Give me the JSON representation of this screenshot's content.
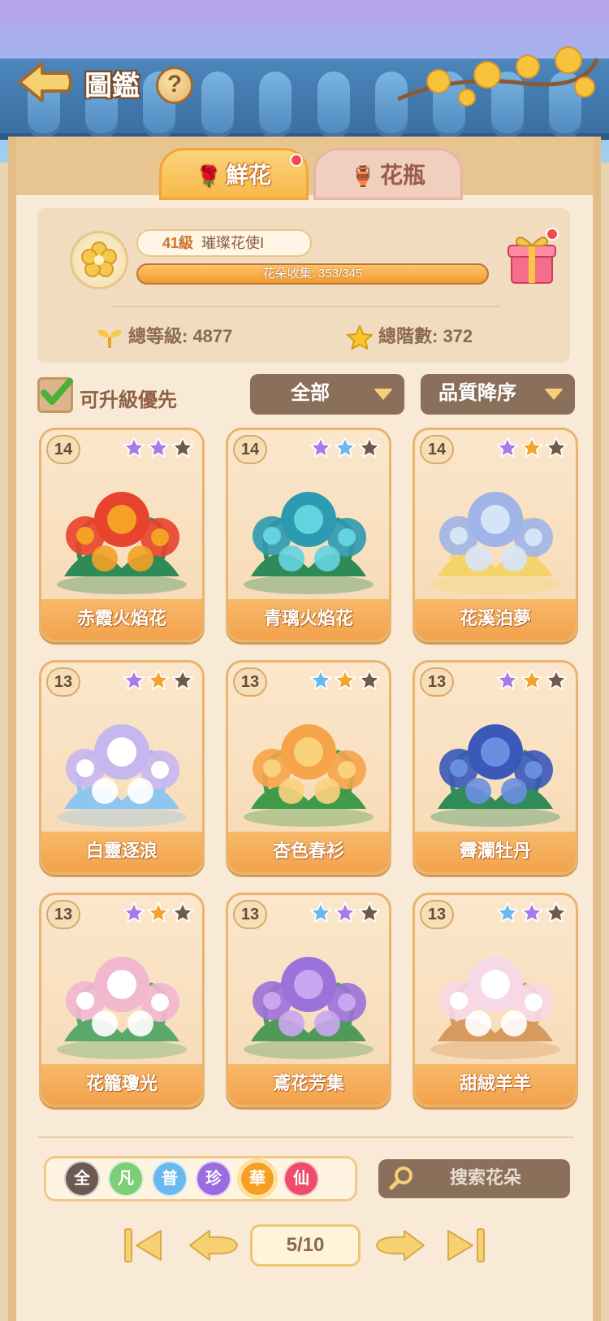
{
  "header": {
    "title": "圖鑑",
    "help_label": "?"
  },
  "tabs": [
    {
      "label": "鮮花",
      "active": true,
      "badge": true
    },
    {
      "label": "花瓶",
      "active": false,
      "badge": false
    }
  ],
  "profile": {
    "level_number": "41級",
    "rank_title": "璀璨花使Ⅰ",
    "progress_text": "花朵收集: 353/345",
    "progress_fraction": 1.0,
    "total_level_text": "總等級: 4877",
    "total_stars_text": "總階數: 372"
  },
  "filters": {
    "upgradable_first_label": "可升級優先",
    "upgradable_first_checked": true,
    "category_value": "全部",
    "sort_value": "品質降序"
  },
  "cards": [
    {
      "level": "14",
      "name": "赤霞火焰花",
      "stars": [
        "#a87ce8",
        "#a87ce8",
        "#6f5a4c"
      ],
      "palette": [
        "#e8432c",
        "#f4a126",
        "#2e8b57"
      ]
    },
    {
      "level": "14",
      "name": "青璃火焰花",
      "stars": [
        "#a87ce8",
        "#6bb8ef",
        "#6f5a4c"
      ],
      "palette": [
        "#2c9ab0",
        "#64d3e0",
        "#2e8b57"
      ]
    },
    {
      "level": "14",
      "name": "花溪泊夢",
      "stars": [
        "#a87ce8",
        "#f3a42a",
        "#6f5a4c"
      ],
      "palette": [
        "#9fb5e8",
        "#d6e4f7",
        "#f3d36a"
      ]
    },
    {
      "level": "13",
      "name": "白靈逐浪",
      "stars": [
        "#a87ce8",
        "#f3a42a",
        "#6f5a4c"
      ],
      "palette": [
        "#c7b7ef",
        "#ffffff",
        "#8fc6ef"
      ]
    },
    {
      "level": "13",
      "name": "杏色春衫",
      "stars": [
        "#6bb8ef",
        "#f3a42a",
        "#6f5a4c"
      ],
      "palette": [
        "#f5a44a",
        "#fbd27c",
        "#3f9a4a"
      ]
    },
    {
      "level": "13",
      "name": "霽瀾牡丹",
      "stars": [
        "#a87ce8",
        "#f3a42a",
        "#6f5a4c"
      ],
      "palette": [
        "#3a59b8",
        "#6b8fe0",
        "#2f8b5a"
      ]
    },
    {
      "level": "13",
      "name": "花籠瓊光",
      "stars": [
        "#a87ce8",
        "#f3a42a",
        "#6f5a4c"
      ],
      "palette": [
        "#f2b8cf",
        "#ffffff",
        "#5aa86a"
      ]
    },
    {
      "level": "13",
      "name": "鳶花芳集",
      "stars": [
        "#6bb8ef",
        "#a87ce8",
        "#6f5a4c"
      ],
      "palette": [
        "#9b72d9",
        "#c9a6f0",
        "#4f9a58"
      ]
    },
    {
      "level": "13",
      "name": "甜絨羊羊",
      "stars": [
        "#6bb8ef",
        "#a87ce8",
        "#6f5a4c"
      ],
      "palette": [
        "#f6d8e6",
        "#ffffff",
        "#d79a5c"
      ]
    }
  ],
  "rarities": [
    {
      "label": "全",
      "color": "#6b5a52"
    },
    {
      "label": "凡",
      "color": "#7ccf76"
    },
    {
      "label": "普",
      "color": "#6bb8ef"
    },
    {
      "label": "珍",
      "color": "#9b6be0"
    },
    {
      "label": "華",
      "color": "#f5a024"
    },
    {
      "label": "仙",
      "color": "#ef4c6a"
    }
  ],
  "search": {
    "placeholder": "搜索花朵"
  },
  "pager": {
    "page_text": "5/10"
  }
}
